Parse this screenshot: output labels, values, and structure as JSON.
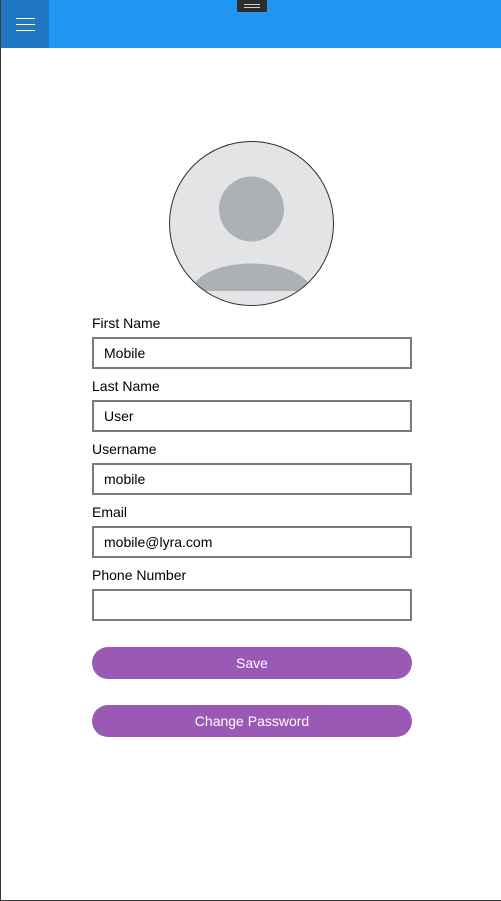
{
  "colors": {
    "topbar": "#2196f3",
    "menu_button": "#1f76c2",
    "button_fill": "#9b59b6",
    "avatar_background": "#e3e4e6",
    "avatar_silhouette": "#adb1b6"
  },
  "topbar": {
    "menu_icon": "hamburger-menu-icon",
    "caption_handle_icon": "drag-handle-icon"
  },
  "profile": {
    "avatar_icon": "default-user-silhouette-icon",
    "fields": {
      "first_name": {
        "label": "First Name",
        "value": "Mobile"
      },
      "last_name": {
        "label": "Last Name",
        "value": "User"
      },
      "username": {
        "label": "Username",
        "value": "mobile"
      },
      "email": {
        "label": "Email",
        "value": "mobile@lyra.com"
      },
      "phone": {
        "label": "Phone Number",
        "value": ""
      }
    },
    "save_label": "Save",
    "change_password_label": "Change Password"
  }
}
